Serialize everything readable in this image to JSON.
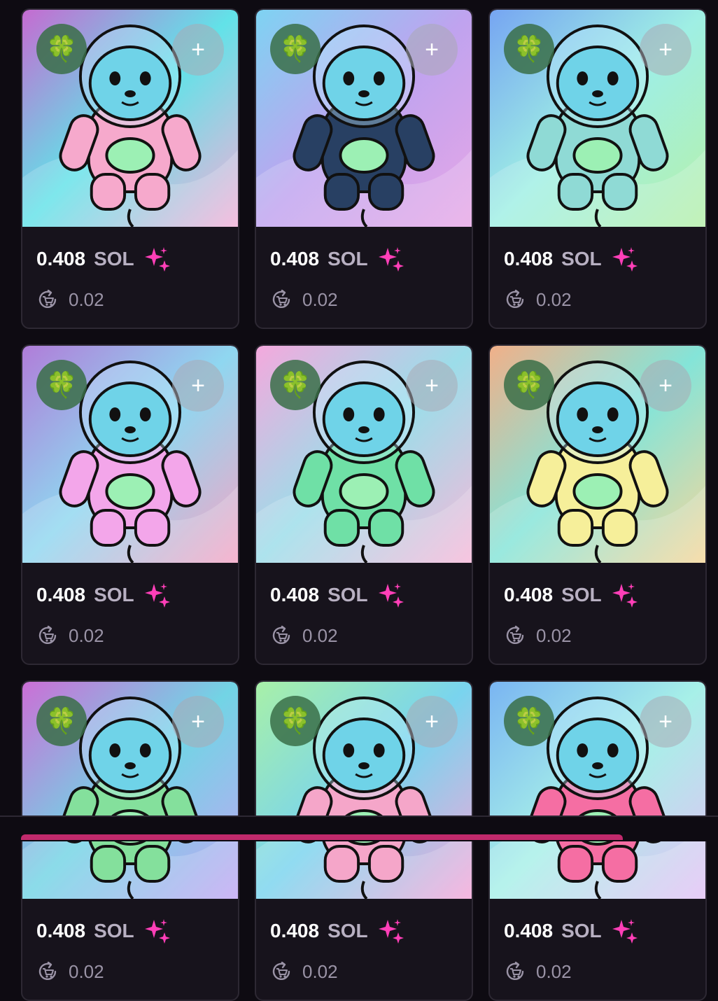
{
  "cards": [
    {
      "price": "0.408",
      "currency": "SOL",
      "fee": "0.02",
      "bg": [
        "#c56bd1",
        "#62e2e8",
        "#f3b0d8"
      ],
      "suit": "#f6a9cc"
    },
    {
      "price": "0.408",
      "currency": "SOL",
      "fee": "0.02",
      "bg": [
        "#7ed3f2",
        "#bfa3ef",
        "#e7a6e6"
      ],
      "suit": "#284063"
    },
    {
      "price": "0.408",
      "currency": "SOL",
      "fee": "0.02",
      "bg": [
        "#76a5f2",
        "#9fefe4",
        "#b6f0a9"
      ],
      "suit": "#8fdad5"
    },
    {
      "price": "0.408",
      "currency": "SOL",
      "fee": "0.02",
      "bg": [
        "#b07dd9",
        "#8fd7f0",
        "#f5a5c5"
      ],
      "suit": "#f3a6ea"
    },
    {
      "price": "0.408",
      "currency": "SOL",
      "fee": "0.02",
      "bg": [
        "#f4a9dd",
        "#9cdde9",
        "#f6b8d9"
      ],
      "suit": "#6fe0a6"
    },
    {
      "price": "0.408",
      "currency": "SOL",
      "fee": "0.02",
      "bg": [
        "#f1b089",
        "#84e4d8",
        "#f6d69a"
      ],
      "suit": "#f6ef9a"
    },
    {
      "price": "0.408",
      "currency": "SOL",
      "fee": "0.02",
      "bg": [
        "#cb6fd6",
        "#72d4e5",
        "#c2a6f3"
      ],
      "suit": "#84e09c"
    },
    {
      "price": "0.408",
      "currency": "SOL",
      "fee": "0.02",
      "bg": [
        "#a8f0a8",
        "#79d4ee",
        "#f5a7d9"
      ],
      "suit": "#f5a6c9"
    },
    {
      "price": "0.408",
      "currency": "SOL",
      "fee": "0.02",
      "bg": [
        "#7ab5f2",
        "#a7f0e8",
        "#e3c1f5"
      ],
      "suit": "#f56ea3"
    }
  ],
  "icons": {
    "luck": "four-leaf-clover-icon",
    "add": "plus-icon",
    "sparkle": "sparkles-icon",
    "fee": "cart-refresh-icon"
  },
  "labels": {
    "luck_glyph": "🍀",
    "add_glyph": "+"
  },
  "colors": {
    "background": "#0e0b12",
    "card": "#17131c",
    "card_border": "#2d2833",
    "sparkle": "#ff3fb8",
    "bottom_accent": "#c12a6c"
  }
}
